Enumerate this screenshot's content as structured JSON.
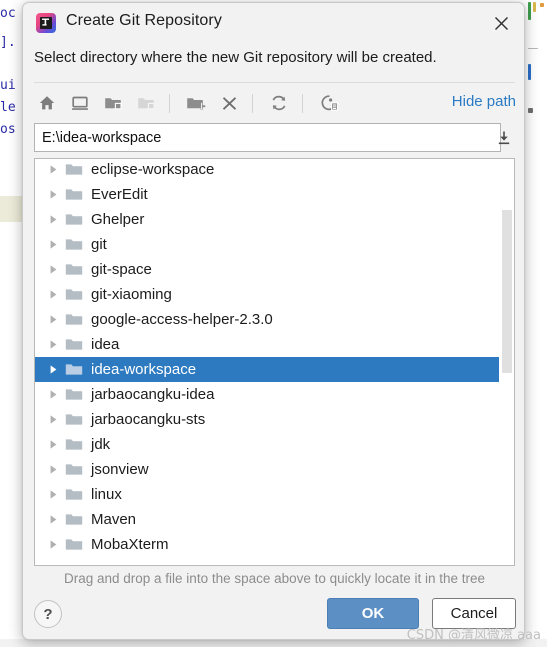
{
  "window": {
    "title": "Create Git Repository",
    "app_icon": "intellij-idea-logo",
    "close_icon": "close-icon"
  },
  "prompt": "Select directory where the new Git repository will be created.",
  "toolbar": {
    "hide_path_label": "Hide path",
    "buttons": [
      {
        "name": "home-icon",
        "title": "Home"
      },
      {
        "name": "desktop-icon",
        "title": "Desktop"
      },
      {
        "name": "project-folder-icon",
        "title": "Project Directory"
      },
      {
        "name": "module-folder-icon",
        "title": "Module Directory",
        "disabled": true
      },
      {
        "name": "new-folder-icon",
        "title": "New Folder"
      },
      {
        "name": "delete-icon",
        "title": "Delete"
      },
      {
        "name": "refresh-icon",
        "title": "Refresh"
      },
      {
        "name": "show-hidden-files-icon",
        "title": "Show Hidden Files"
      }
    ]
  },
  "path_field": {
    "value": "E:\\idea-workspace",
    "placeholder": "",
    "collapse_icon": "collapse-down-icon"
  },
  "tree": {
    "items": [
      {
        "label": "eclipse-workspace",
        "selected": false
      },
      {
        "label": "EverEdit",
        "selected": false
      },
      {
        "label": "Ghelper",
        "selected": false
      },
      {
        "label": "git",
        "selected": false
      },
      {
        "label": "git-space",
        "selected": false
      },
      {
        "label": "git-xiaoming",
        "selected": false
      },
      {
        "label": "google-access-helper-2.3.0",
        "selected": false
      },
      {
        "label": "idea",
        "selected": false
      },
      {
        "label": "idea-workspace",
        "selected": true
      },
      {
        "label": "jarbaocangku-idea",
        "selected": false
      },
      {
        "label": "jarbaocangku-sts",
        "selected": false
      },
      {
        "label": "jdk",
        "selected": false
      },
      {
        "label": "jsonview",
        "selected": false
      },
      {
        "label": "linux",
        "selected": false
      },
      {
        "label": "Maven",
        "selected": false
      },
      {
        "label": "MobaXterm",
        "selected": false
      }
    ],
    "selection_color": "#2d7ac0"
  },
  "hint": "Drag and drop a file into the space above to quickly locate it in the tree",
  "footer": {
    "help_label": "?",
    "ok_label": "OK",
    "cancel_label": "Cancel",
    "ok_color": "#5c8fc4"
  },
  "watermark": "CSDN @清风微凉 aaa",
  "background": {
    "code_fragments": [
      "oc",
      "].",
      "ui",
      "le",
      "os"
    ]
  }
}
